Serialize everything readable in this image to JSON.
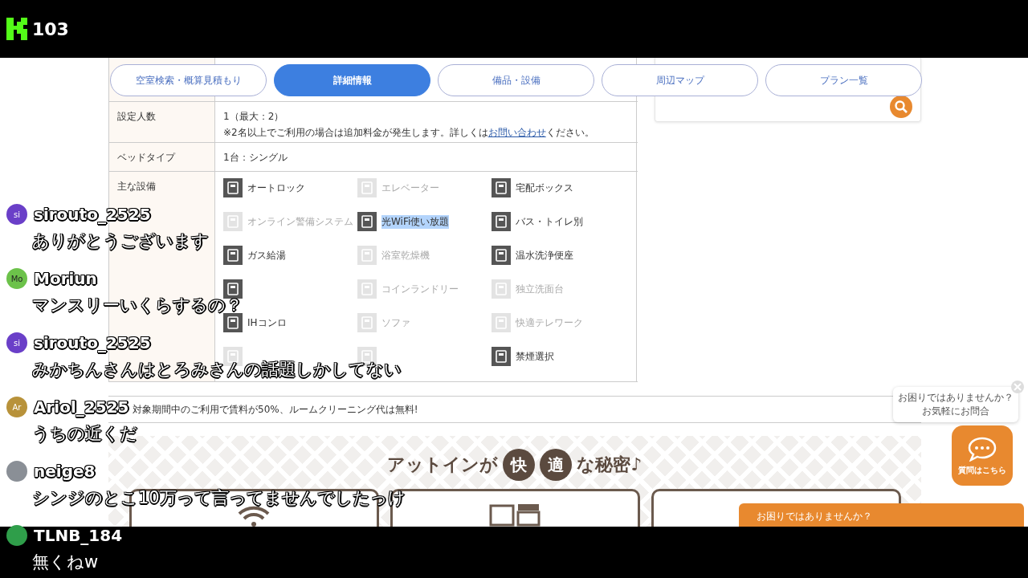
{
  "stream": {
    "viewer_count": "103"
  },
  "tabs": [
    {
      "label": "空室検索・概算見積もり",
      "selected": false
    },
    {
      "label": "詳細情報",
      "selected": true
    },
    {
      "label": "備品・設備",
      "selected": false
    },
    {
      "label": "周辺マップ",
      "selected": false
    },
    {
      "label": "プラン一覧",
      "selected": false
    }
  ],
  "details": {
    "guests": {
      "label": "設定人数",
      "value": "1（最大：2）",
      "note_before": "※2名以上でご利用の場合は追加料金が発生します。詳しくは",
      "note_link": "お問い合わせ",
      "note_after": "ください。"
    },
    "bed": {
      "label": "ベッドタイプ",
      "value": "1台：シングル"
    },
    "amenities_label": "主な設備",
    "amenities": [
      {
        "label": "オートロック",
        "available": true,
        "highlighted": false
      },
      {
        "label": "エレベーター",
        "available": false,
        "highlighted": false
      },
      {
        "label": "宅配ボックス",
        "available": true,
        "highlighted": false
      },
      {
        "label": "オンライン警備システム",
        "available": false,
        "highlighted": false
      },
      {
        "label": "光WiFi使い放題",
        "available": true,
        "highlighted": true
      },
      {
        "label": "バス・トイレ別",
        "available": true,
        "highlighted": false
      },
      {
        "label": "ガス給湯",
        "available": true,
        "highlighted": false
      },
      {
        "label": "浴室乾燥機",
        "available": false,
        "highlighted": false
      },
      {
        "label": "温水洗浄便座",
        "available": true,
        "highlighted": false
      },
      {
        "available": true
      },
      {
        "label": "コインランドリー",
        "available": false,
        "highlighted": false
      },
      {
        "label": "独立洗面台",
        "available": false,
        "highlighted": false
      },
      {
        "label": "IHコンロ",
        "available": true,
        "highlighted": false
      },
      {
        "label": "ソファ",
        "available": false,
        "highlighted": false
      },
      {
        "label": "快適テレワーク",
        "available": false,
        "highlighted": false
      },
      {
        "available": false
      },
      {
        "available": false
      },
      {
        "label": "禁煙選択",
        "available": true,
        "highlighted": false
      }
    ]
  },
  "campaign": "対象期間中のご利用で賃料が50%、ルームクリーニング代は無料!",
  "banner": {
    "before": "アットインが",
    "marks": [
      "快",
      "適"
    ],
    "after": "な秘密♪"
  },
  "help_bubble": {
    "line1": "お困りではありませんか？",
    "line2": "お気軽にお問合"
  },
  "chat_button": "質問はこちら",
  "help_bar": "お困りではありませんか？",
  "chat": [
    {
      "name": "sirouto_2525",
      "message": "ありがとうございます",
      "initials": "si",
      "color": "#6a3fc8"
    },
    {
      "name": "Moriun",
      "message": "マンスリーいくらするの？",
      "initials": "Mo",
      "color": "#6cc24a"
    },
    {
      "name": "sirouto_2525",
      "message": "みかちんさんはとろみさんの話題しかしてない",
      "initials": "si",
      "color": "#6a3fc8"
    },
    {
      "name": "Ariol_2525",
      "message": "うちの近くだ",
      "initials": "Ar",
      "color": "#b8923a"
    },
    {
      "name": "neige8",
      "message": "シンジのとこ10万って言ってませんでしたっけ",
      "color": "#8a8f96"
    },
    {
      "name": "TLNB_184",
      "message": "無くねw",
      "color": "#2f9e4a"
    }
  ]
}
